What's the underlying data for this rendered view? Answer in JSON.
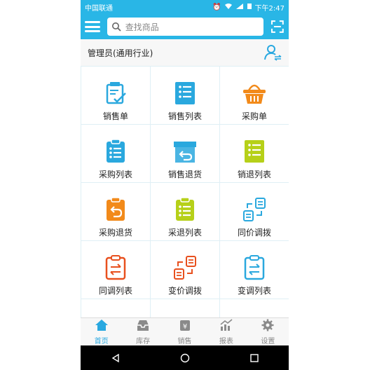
{
  "status": {
    "carrier": "中国联通",
    "time": "下午2:47"
  },
  "search": {
    "placeholder": "查找商品"
  },
  "user": {
    "name": "管理员(通用行业)"
  },
  "grid": {
    "items": [
      {
        "label": "销售单",
        "icon": "sales-order-icon",
        "color": "#2aa8de"
      },
      {
        "label": "销售列表",
        "icon": "list-icon",
        "color": "#2aa8de"
      },
      {
        "label": "采购单",
        "icon": "basket-icon",
        "color": "#f28a1a"
      },
      {
        "label": "采购列表",
        "icon": "clipboard-list-icon",
        "color": "#2aa8de"
      },
      {
        "label": "销售退货",
        "icon": "return-box-icon",
        "color": "#2aa8de"
      },
      {
        "label": "销退列表",
        "icon": "list-icon",
        "color": "#b6d019"
      },
      {
        "label": "采购退货",
        "icon": "return-clipboard-icon",
        "color": "#f28a1a"
      },
      {
        "label": "采退列表",
        "icon": "clipboard-list-icon",
        "color": "#b6d019"
      },
      {
        "label": "同价调拨",
        "icon": "transfer-icon",
        "color": "#2aa8de"
      },
      {
        "label": "同调列表",
        "icon": "transfer-clipboard-icon",
        "color": "#e8501e"
      },
      {
        "label": "变价调拨",
        "icon": "transfer-icon",
        "color": "#e8501e"
      },
      {
        "label": "变调列表",
        "icon": "transfer-clipboard-icon",
        "color": "#2aa8de"
      }
    ]
  },
  "tabs": [
    {
      "label": "首页",
      "icon": "home-icon",
      "active": true
    },
    {
      "label": "库存",
      "icon": "inbox-icon",
      "active": false
    },
    {
      "label": "销售",
      "icon": "sales-icon",
      "active": false
    },
    {
      "label": "报表",
      "icon": "chart-icon",
      "active": false
    },
    {
      "label": "设置",
      "icon": "gear-icon",
      "active": false
    }
  ]
}
